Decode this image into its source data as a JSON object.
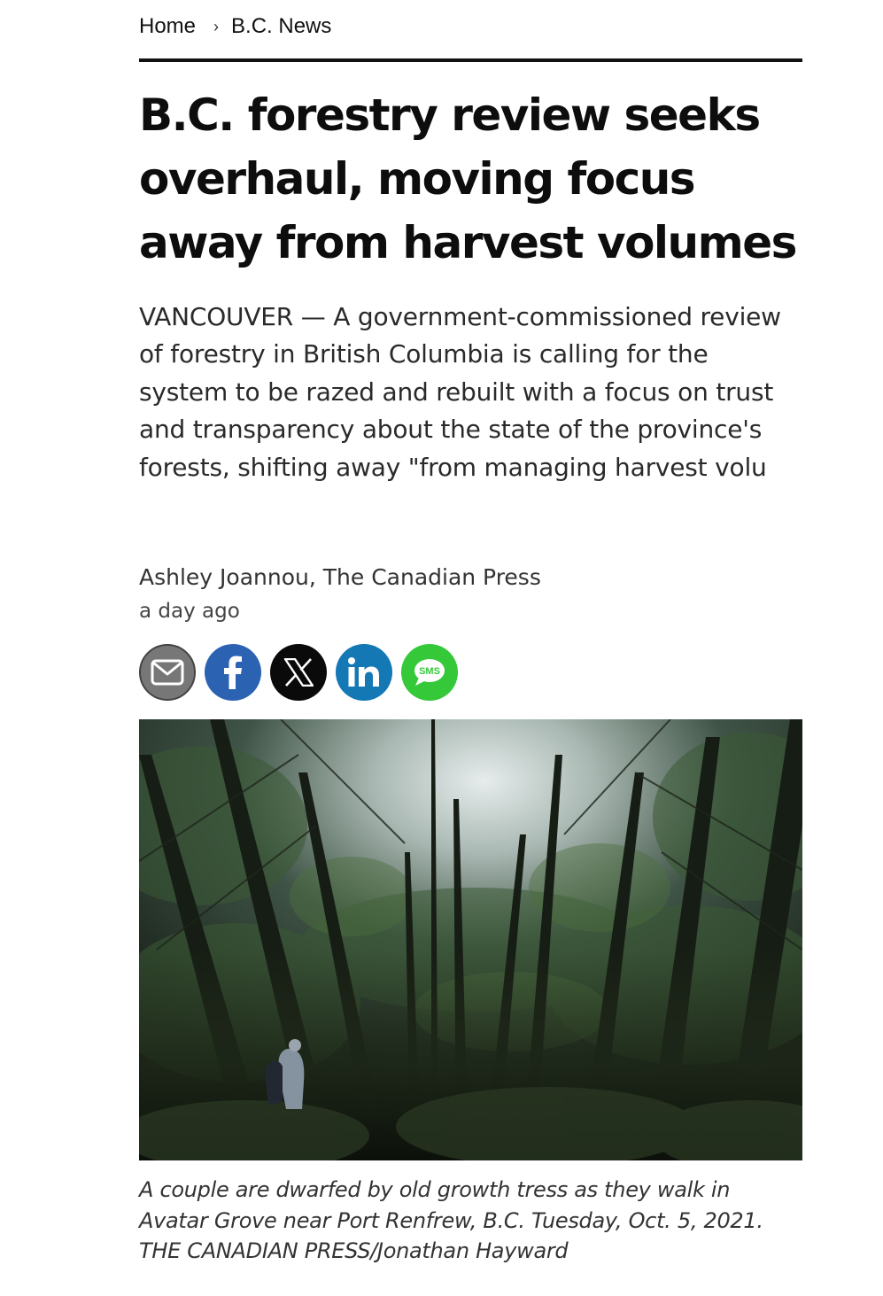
{
  "breadcrumb": {
    "home": "Home",
    "separator": "›",
    "section": "B.C. News"
  },
  "article": {
    "headline": "B.C. forestry review seeks overhaul, moving focus away from harvest volumes",
    "summary": "VANCOUVER — A government-commissioned review of forestry in British Columbia is calling for the system to be razed and rebuilt with a focus on trust and transparency about the state of the province's forests, shifting away \"from managing harvest volu",
    "byline": "Ashley Joannou, The Canadian Press",
    "timestamp": "a day ago"
  },
  "share": {
    "buttons": [
      {
        "icon": "email-icon",
        "color": "#777777"
      },
      {
        "icon": "facebook-icon",
        "color": "#2c62b2"
      },
      {
        "icon": "x-icon",
        "color": "#0a0a0a"
      },
      {
        "icon": "linkedin-icon",
        "color": "#1478b5"
      },
      {
        "icon": "sms-icon",
        "color": "#35c93a",
        "label": "SMS"
      }
    ]
  },
  "photo": {
    "caption": "A couple are dwarfed by old growth tress as they walk in Avatar Grove near Port Renfrew, B.C. Tuesday, Oct. 5, 2021. THE CANADIAN PRESS/Jonathan Hayward"
  }
}
